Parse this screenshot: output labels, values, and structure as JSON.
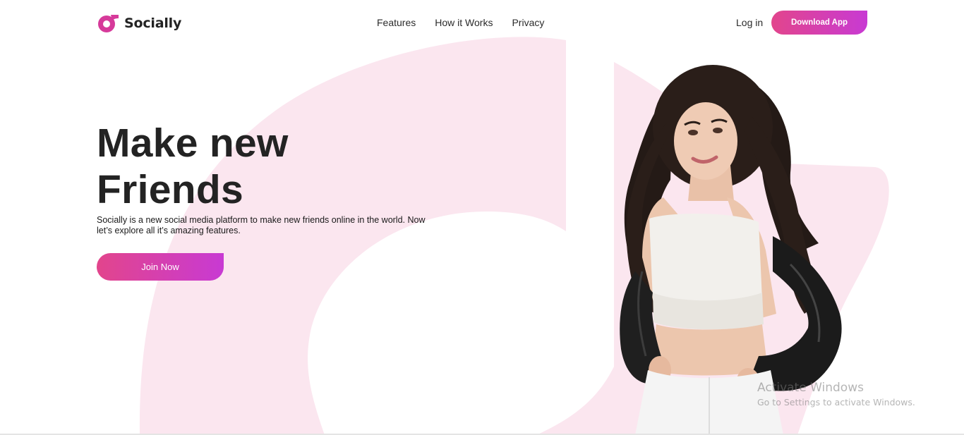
{
  "brand": {
    "name": "Socially",
    "accent": "#e2458c",
    "accent_end": "#c83ad3",
    "shape_tint": "#fbe6ef"
  },
  "nav": {
    "items": [
      {
        "label": "Features"
      },
      {
        "label": "How it Works"
      },
      {
        "label": "Privacy"
      }
    ]
  },
  "header": {
    "login_label": "Log in",
    "download_label": "Download App"
  },
  "hero": {
    "title_line1": "Make new",
    "title_line2": "Friends",
    "description": "Socially is a new social media platform to make new friends online in the world. Now let’s explore all it’s amazing features.",
    "cta_label": "Join Now"
  },
  "watermark": {
    "title": "Activate Windows",
    "subtitle": "Go to Settings to activate Windows."
  }
}
